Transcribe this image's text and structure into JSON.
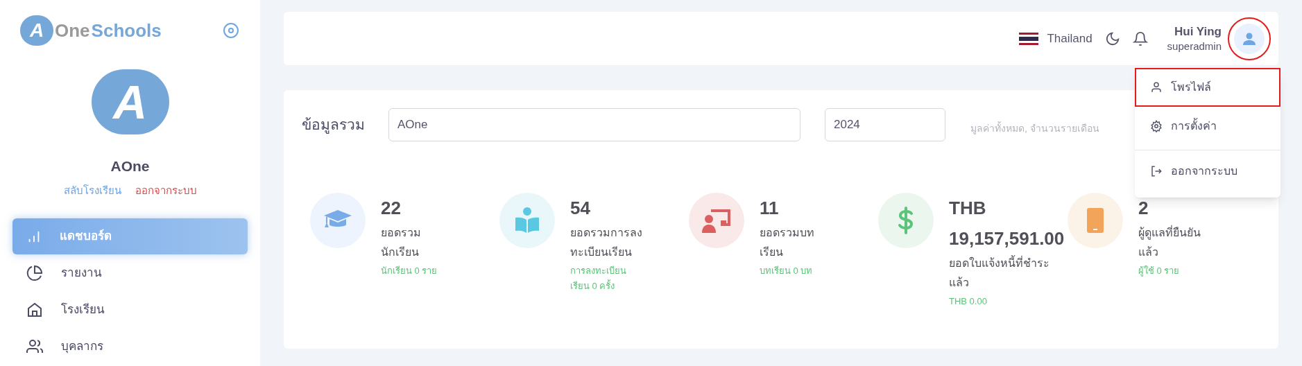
{
  "logo": {
    "mark": "A",
    "word_1": "One",
    "word_2": "Schools"
  },
  "school": {
    "mark": "A",
    "name": "AOne",
    "switch_link": "สลับโรงเรียน",
    "logout_link": "ออกจากระบบ"
  },
  "sidebar": {
    "items": [
      {
        "label": "แดชบอร์ด",
        "selected": true
      },
      {
        "label": "รายงาน",
        "selected": false
      },
      {
        "label": "โรงเรียน",
        "selected": false
      },
      {
        "label": "บุคลากร",
        "selected": false
      }
    ]
  },
  "header": {
    "language": "Thailand",
    "user": {
      "name": "Hui Ying",
      "role": "superadmin",
      "annotated": true
    }
  },
  "user_menu": {
    "items": [
      {
        "label": "โพรไฟล์",
        "annotated": true
      },
      {
        "label": "การตั้งค่า",
        "annotated": false
      },
      {
        "label": "ออกจากระบบ",
        "annotated": false
      }
    ]
  },
  "overview": {
    "title": "ข้อมูลรวม",
    "school_field": "AOne",
    "year_field": "2024",
    "hint": "มูลค่าทั้งหมด, จำนวนรายเดือน"
  },
  "stats": [
    {
      "value": "22",
      "label": "ยอดรวมนักเรียน",
      "sub": "นักเรียน 0 ราย"
    },
    {
      "value": "54",
      "label": "ยอดรวมการลงทะเบียนเรียน",
      "sub": "การลงทะเบียนเรียน 0 ครั้ง"
    },
    {
      "value": "11",
      "label": "ยอดรวมบทเรียน",
      "sub": "บทเรียน 0 บท"
    },
    {
      "value": "THB 19,157,591.00",
      "label": "ยอดใบแจ้งหนี้ที่ชำระแล้ว",
      "sub": "THB 0.00"
    },
    {
      "value": "2",
      "label": "ผู้ดูแลที่ยืนยันแล้ว",
      "sub": "ผู้ใช้ 0 ราย"
    }
  ]
}
